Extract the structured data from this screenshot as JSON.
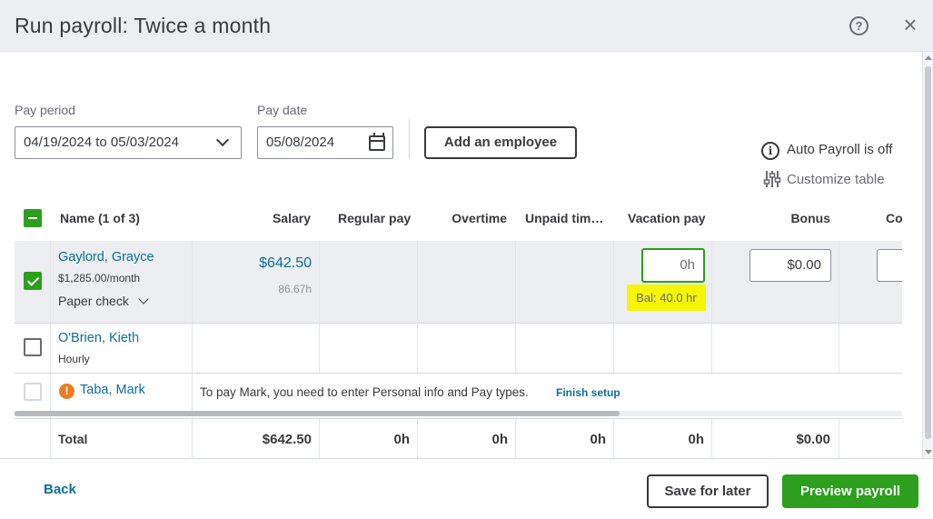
{
  "header": {
    "title": "Run payroll: Twice a month",
    "help_icon": "question-circle-icon",
    "close_icon": "close-icon"
  },
  "controls": {
    "pay_period_label": "Pay period",
    "pay_period_value": "04/19/2024 to 05/03/2024",
    "pay_date_label": "Pay date",
    "pay_date_value": "05/08/2024",
    "add_employee_label": "Add an employee",
    "auto_payroll_text": "Auto Payroll is off",
    "customize_table_text": "Customize table"
  },
  "table": {
    "columns": {
      "name": "Name (1 of 3)",
      "salary": "Salary",
      "regular_pay": "Regular pay",
      "overtime": "Overtime",
      "unpaid_time": "Unpaid tim…",
      "vacation_pay": "Vacation pay",
      "bonus": "Bonus",
      "co": "Co"
    },
    "rows": [
      {
        "name": "Gaylord, Grayce",
        "rate": "$1,285.00/month",
        "payment_method": "Paper check",
        "salary": "$642.50",
        "salary_hours": "86.67h",
        "vacation_value": "0h",
        "vacation_balance": "Bal: 40.0 hr",
        "bonus_value": "$0.00",
        "checked": true
      },
      {
        "name": "O'Brien, Kieth",
        "rate": "Hourly",
        "checked": false
      },
      {
        "name": "Taba, Mark",
        "message": "To pay Mark, you need to enter Personal info and Pay types.",
        "action": "Finish setup",
        "checked": false
      }
    ],
    "totals": {
      "label": "Total",
      "salary": "$642.50",
      "regular_pay": "0h",
      "overtime": "0h",
      "unpaid_time": "0h",
      "vacation_pay": "0h",
      "bonus": "$0.00"
    }
  },
  "footer": {
    "back_label": "Back",
    "save_label": "Save for later",
    "preview_label": "Preview payroll"
  },
  "colors": {
    "brand_green": "#2ca01c",
    "link_blue": "#0d6f9a",
    "highlight_yellow": "#f5f50a",
    "warning_orange": "#ec7c20"
  }
}
